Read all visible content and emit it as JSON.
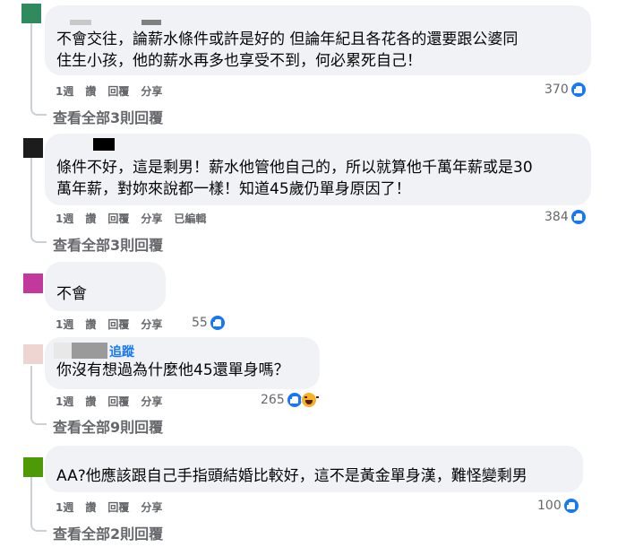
{
  "comments": [
    {
      "avatar_color": "#2f8a5e",
      "text_lines": [
        "不會交往，論薪水條件或許是好的 但論年紀且各花各的還要跟公婆同",
        "住生小孩，他的薪水再多也享受不到，何必累死自己！"
      ],
      "actions": [
        "1週",
        "讚",
        "回覆",
        "分享"
      ],
      "reactions": "370",
      "view_replies": "查看全部3則回覆"
    },
    {
      "avatar_color": "#1c1c1c",
      "text_lines": [
        "條件不好，這是剩男！薪水他管他自己的，所以就算他千萬年薪或是30",
        "萬年薪，對妳來說都一樣！知道45歲仍單身原因了！"
      ],
      "actions": [
        "1週",
        "讚",
        "回覆",
        "分享",
        "已編輯"
      ],
      "reactions": "384",
      "view_replies": "查看全部3則回覆"
    },
    {
      "avatar_color": "#c2399b",
      "text_lines": [
        "不會"
      ],
      "actions": [
        "1週",
        "讚",
        "回覆",
        "分享"
      ],
      "reactions": "55"
    },
    {
      "avatar_color": "#efd5d2",
      "follow_label": "追蹤",
      "text_lines": [
        "你沒有想過為什麼他45還單身嗎？"
      ],
      "actions": [
        "1週",
        "讚",
        "回覆",
        "分享"
      ],
      "reactions": "265",
      "view_replies": "查看全部9則回覆"
    },
    {
      "avatar_color": "#4e9a06",
      "text_lines": [
        "AA?他應該跟自己手指頭結婚比較好，這不是黃金單身漢，難怪變剩男"
      ],
      "actions": [
        "1週",
        "讚",
        "回覆",
        "分享"
      ],
      "reactions": "100",
      "view_replies": "查看全部2則回覆"
    }
  ]
}
